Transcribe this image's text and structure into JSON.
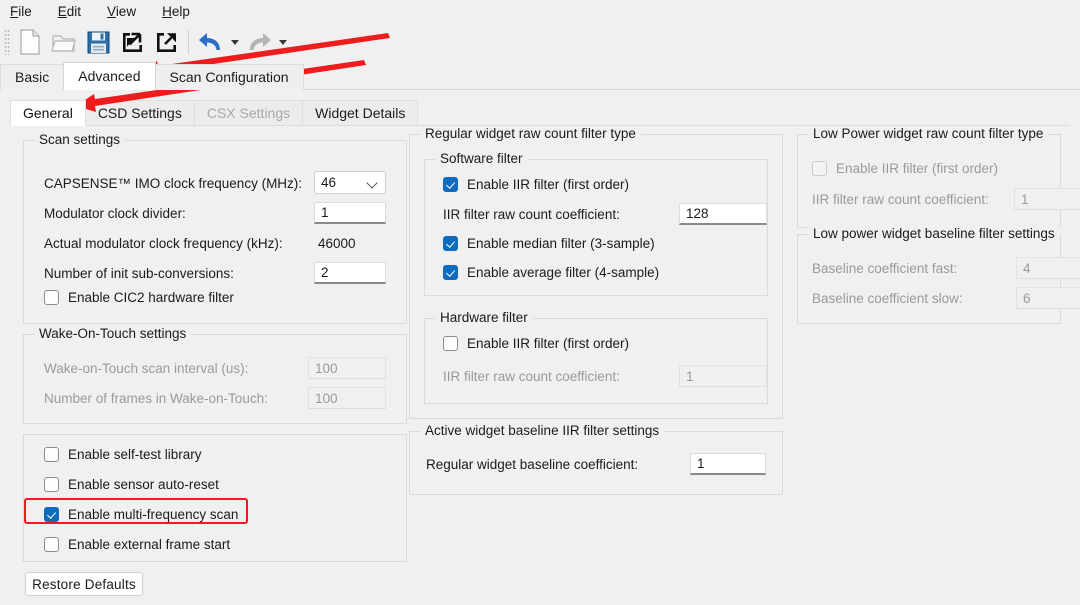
{
  "menu": {
    "items": [
      {
        "label": "File",
        "accel": "F",
        "rest": "ile"
      },
      {
        "label": "Edit",
        "accel": "E",
        "rest": "dit"
      },
      {
        "label": "View",
        "accel": "V",
        "rest": "iew"
      },
      {
        "label": "Help",
        "accel": "H",
        "rest": "elp"
      }
    ]
  },
  "toolbar": {
    "buttons": [
      {
        "name": "new-file-icon",
        "title": "New"
      },
      {
        "name": "open-folder-icon",
        "title": "Open"
      },
      {
        "name": "save-floppy-icon",
        "title": "Save"
      },
      {
        "name": "import-icon",
        "title": "Import"
      },
      {
        "name": "export-icon",
        "title": "Export"
      },
      {
        "name": "undo-icon",
        "title": "Undo"
      },
      {
        "name": "redo-icon",
        "title": "Redo"
      }
    ]
  },
  "outer_tabs": [
    {
      "label": "Basic",
      "active": false
    },
    {
      "label": "Advanced",
      "active": true
    },
    {
      "label": "Scan Configuration",
      "active": false
    }
  ],
  "inner_tabs": [
    {
      "label": "General",
      "active": true,
      "disabled": false
    },
    {
      "label": "CSD Settings",
      "active": false,
      "disabled": false
    },
    {
      "label": "CSX Settings",
      "active": false,
      "disabled": true
    },
    {
      "label": "Widget Details",
      "active": false,
      "disabled": false
    }
  ],
  "scan_settings": {
    "title": "Scan settings",
    "imo_clock_label": "CAPSENSE™ IMO clock frequency (MHz):",
    "imo_clock_value": "46",
    "mod_divider_label": "Modulator clock divider:",
    "mod_divider_value": "1",
    "actual_mod_label": "Actual modulator clock frequency (kHz):",
    "actual_mod_value": "46000",
    "init_subconv_label": "Number of init sub-conversions:",
    "init_subconv_value": "2",
    "cic2_label": "Enable CIC2 hardware filter",
    "cic2_checked": false
  },
  "wake_on_touch": {
    "title": "Wake-On-Touch settings",
    "scan_interval_label": "Wake-on-Touch scan interval (us):",
    "scan_interval_value": "100",
    "frames_label": "Number of frames in Wake-on-Touch:",
    "frames_value": "100"
  },
  "misc_options": {
    "items": [
      {
        "label": "Enable self-test library",
        "checked": false,
        "highlighted": false
      },
      {
        "label": "Enable sensor auto-reset",
        "checked": false,
        "highlighted": false
      },
      {
        "label": "Enable multi-frequency scan",
        "checked": true,
        "highlighted": true
      },
      {
        "label": "Enable external frame start",
        "checked": false,
        "highlighted": false
      }
    ]
  },
  "restore_defaults_label": "Restore Defaults",
  "regular_filter": {
    "title": "Regular widget raw count filter type",
    "software": {
      "title": "Software filter",
      "iir_label": "Enable IIR filter (first order)",
      "iir_checked": true,
      "coeff_label": "IIR filter raw count coefficient:",
      "coeff_value": "128",
      "median_label": "Enable median filter (3-sample)",
      "median_checked": true,
      "average_label": "Enable average filter (4-sample)",
      "average_checked": true
    },
    "hardware": {
      "title": "Hardware filter",
      "iir_label": "Enable IIR filter (first order)",
      "iir_checked": false,
      "coeff_label": "IIR filter raw count coefficient:",
      "coeff_value": "1"
    }
  },
  "active_baseline": {
    "title": "Active widget baseline IIR filter settings",
    "coeff_label": "Regular widget baseline coefficient:",
    "coeff_value": "1"
  },
  "low_power_filter": {
    "title": "Low Power widget raw count filter type",
    "iir_label": "Enable IIR filter (first order)",
    "iir_checked": false,
    "coeff_label": "IIR filter raw count coefficient:",
    "coeff_value": "1"
  },
  "low_power_baseline": {
    "title": "Low power widget baseline filter settings",
    "fast_label": "Baseline coefficient fast:",
    "fast_value": "4",
    "slow_label": "Baseline coefficient slow:",
    "slow_value": "6"
  },
  "colors": {
    "accent_checkbox": "#0f6cbd",
    "annotation_red": "#ee1c1c",
    "window_bg": "#f0f0f0",
    "panel_white": "#ffffff"
  }
}
